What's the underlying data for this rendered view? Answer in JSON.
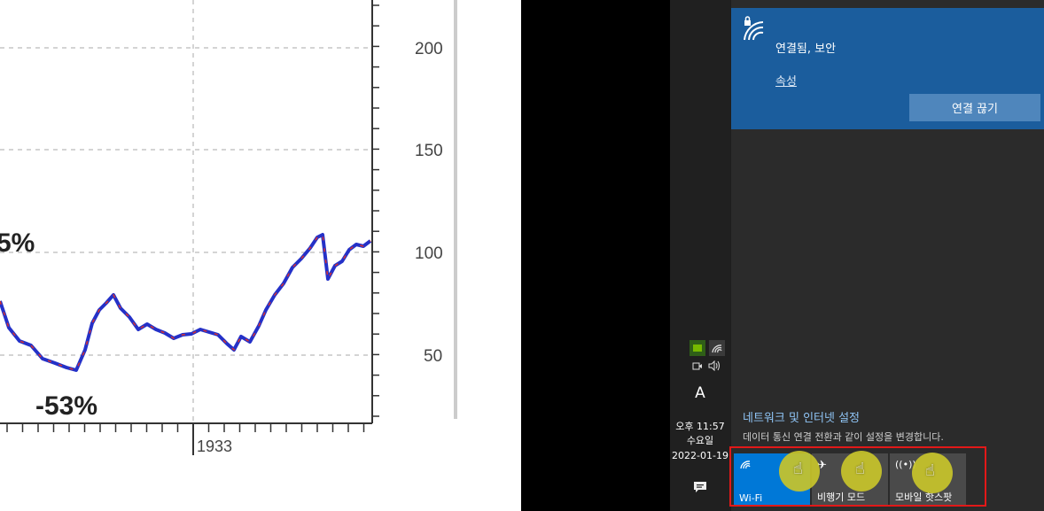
{
  "chart": {
    "y_ticks": [
      "200",
      "150",
      "100",
      "50"
    ],
    "x_tick": "1933",
    "annotation_pct": "5%",
    "annotation_low": "-53%"
  },
  "taskbar": {
    "ime": "A",
    "time": "오후 11:57",
    "weekday": "수요일",
    "date": "2022-01-19"
  },
  "flyout": {
    "wifi_status": "연결됨, 보안",
    "properties_link": "속성",
    "disconnect_button": "연결 끊기",
    "settings_link": "네트워크 및 인터넷 설정",
    "settings_desc": "데이터 통신 연결 전환과 같이 설정을 변경합니다.",
    "tiles": [
      "Wi-Fi",
      "비행기 모드",
      "모바일 핫스팟"
    ]
  },
  "colors": {
    "accent_blue": "#0078d7",
    "card_blue": "#1b5d9d",
    "highlight": "#c8c42a",
    "red_box": "#e21818"
  }
}
